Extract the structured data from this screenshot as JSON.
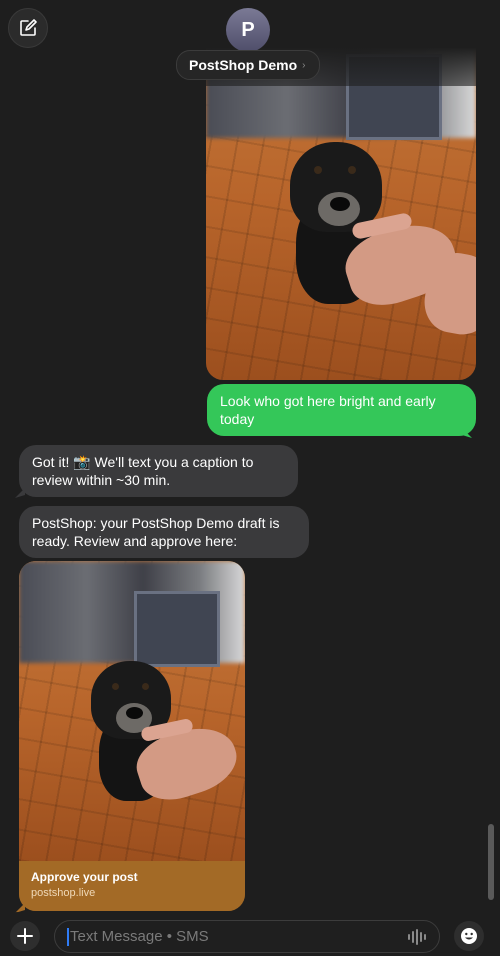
{
  "header": {
    "contact_initial": "P",
    "contact_name": "PostShop Demo",
    "chevron": "›",
    "compose_icon": "compose-icon"
  },
  "messages": [
    {
      "direction": "outgoing",
      "type": "image",
      "description_icon": "photo-icon"
    },
    {
      "direction": "outgoing",
      "type": "text",
      "text": "Look who got here bright and early today"
    },
    {
      "direction": "incoming",
      "type": "text",
      "text": "Got it! 📸 We'll text you a caption to review within ~30 min."
    },
    {
      "direction": "incoming",
      "type": "text",
      "text": "PostShop: your PostShop Demo  draft is ready. Review and approve here:"
    },
    {
      "direction": "incoming",
      "type": "link",
      "title": "Approve your post",
      "url": "postshop.live"
    }
  ],
  "input": {
    "placeholder": "Text Message • SMS",
    "plus_icon": "plus-icon",
    "voice_icon": "waveform-icon",
    "emoji_icon": "emoji-icon"
  },
  "colors": {
    "outgoing_bubble": "#34c759",
    "incoming_bubble": "#3a3a3c",
    "background": "#1e1e1e",
    "link_card": "#a36a26"
  }
}
